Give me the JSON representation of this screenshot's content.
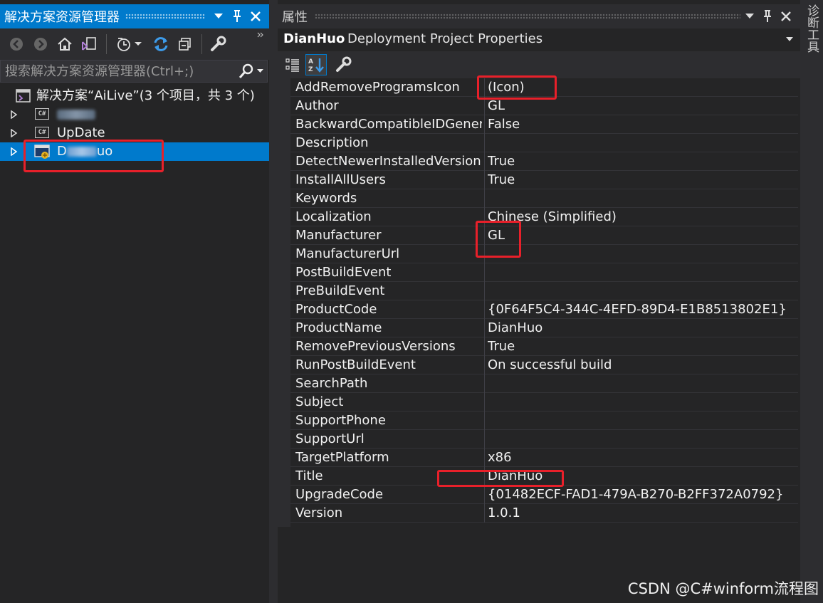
{
  "solution_explorer": {
    "title": "解决方案资源管理器",
    "search_placeholder": "搜索解决方案资源管理器(Ctrl+;)",
    "solution_label": "解决方案“AiLive”(3 个项目，共 3 个)",
    "projects": [
      {
        "label": "",
        "blurred": true,
        "icon": "csharp-project-icon"
      },
      {
        "label": "UpDate",
        "icon": "csharp-project-icon"
      },
      {
        "label_prefix": "D",
        "label_suffix": "uo",
        "blurred": true,
        "icon": "setup-project-icon",
        "selected": true
      }
    ]
  },
  "properties": {
    "title": "属性",
    "object_name": "DianHuo",
    "object_type": "Deployment Project Properties",
    "rows": [
      {
        "name": "AddRemoveProgramsIcon",
        "value": "(Icon)"
      },
      {
        "name": "Author",
        "value": "GL"
      },
      {
        "name": "BackwardCompatibleIDGenera",
        "value": "False"
      },
      {
        "name": "Description",
        "value": ""
      },
      {
        "name": "DetectNewerInstalledVersion",
        "value": "True"
      },
      {
        "name": "InstallAllUsers",
        "value": "True"
      },
      {
        "name": "Keywords",
        "value": ""
      },
      {
        "name": "Localization",
        "value": "Chinese (Simplified)"
      },
      {
        "name": "Manufacturer",
        "value": "GL"
      },
      {
        "name": "ManufacturerUrl",
        "value": ""
      },
      {
        "name": "PostBuildEvent",
        "value": ""
      },
      {
        "name": "PreBuildEvent",
        "value": ""
      },
      {
        "name": "ProductCode",
        "value": "{0F64F5C4-344C-4EFD-89D4-E1B8513802E1}"
      },
      {
        "name": "ProductName",
        "value": "DianHuo"
      },
      {
        "name": "RemovePreviousVersions",
        "value": "True"
      },
      {
        "name": "RunPostBuildEvent",
        "value": "On successful build"
      },
      {
        "name": "SearchPath",
        "value": ""
      },
      {
        "name": "Subject",
        "value": ""
      },
      {
        "name": "SupportPhone",
        "value": ""
      },
      {
        "name": "SupportUrl",
        "value": ""
      },
      {
        "name": "TargetPlatform",
        "value": "x86"
      },
      {
        "name": "Title",
        "value": "DianHuo"
      },
      {
        "name": "UpgradeCode",
        "value": "{01482ECF-FAD1-479A-B270-B2FF372A0792}"
      },
      {
        "name": "Version",
        "value": "1.0.1"
      }
    ]
  },
  "side_tab": {
    "label": "诊断工具"
  },
  "watermark": "CSDN @C#winform流程图",
  "colors": {
    "accent": "#007acc",
    "highlight": "#e8202a",
    "background": "#252526"
  }
}
